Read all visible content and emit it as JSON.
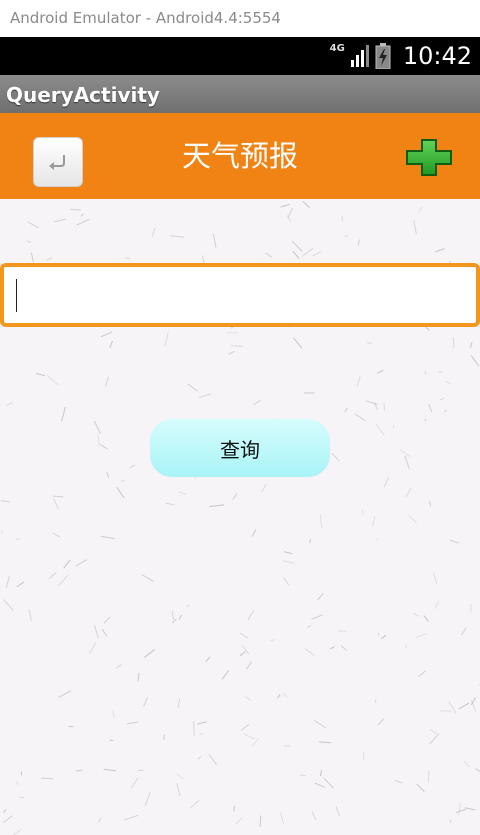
{
  "emulator": {
    "title": "Android Emulator - Android4.4:5554"
  },
  "statusbar": {
    "network": "4G",
    "time": "10:42"
  },
  "actionbar": {
    "title": "QueryActivity"
  },
  "toolbar": {
    "title": "天气预报",
    "accent": "#f08314"
  },
  "search": {
    "value": "",
    "placeholder": ""
  },
  "query_button": {
    "label": "查询"
  }
}
